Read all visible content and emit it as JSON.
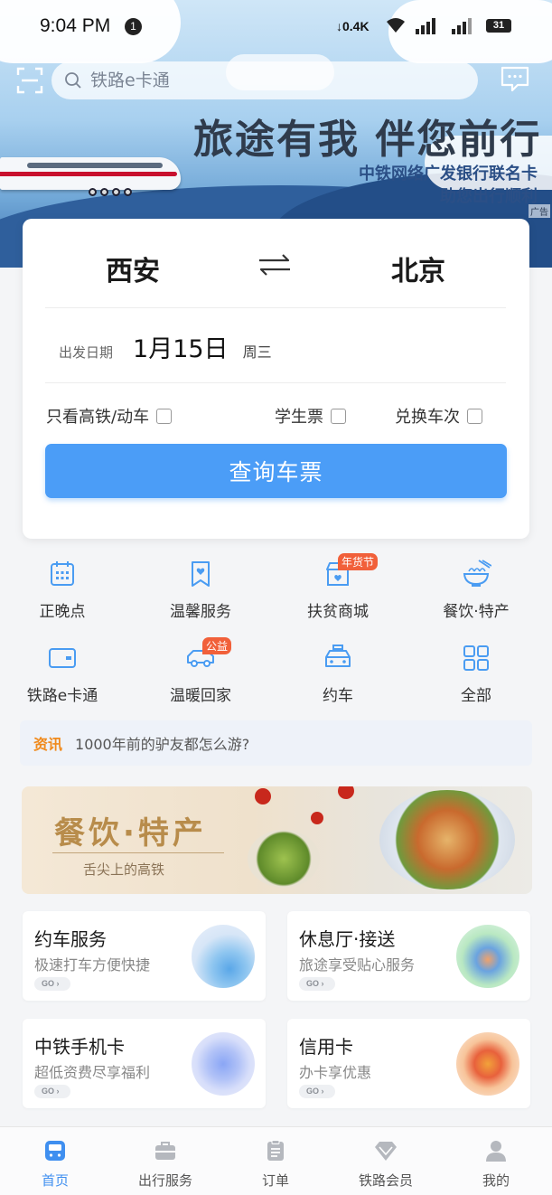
{
  "status_bar": {
    "time": "9:04 PM",
    "notification_count": "1",
    "net_speed": "0.4K",
    "battery": "31"
  },
  "search": {
    "placeholder": "铁路e卡通"
  },
  "banner": {
    "slogan": "旅途有我 伴您前行",
    "line1": "中铁网络广发银行联名卡",
    "line2": "助您出行顺利",
    "ad_tag": "广告"
  },
  "booking": {
    "from_city": "西安",
    "to_city": "北京",
    "date_label": "出发日期",
    "date_value": "1月15日",
    "weekday": "周三",
    "options": [
      {
        "label": "只看高铁/动车",
        "checked": false
      },
      {
        "label": "学生票",
        "checked": false
      },
      {
        "label": "兑换车次",
        "checked": false
      }
    ],
    "query_button": "查询车票"
  },
  "grid": [
    {
      "label": "正晚点",
      "icon": "calendar-icon"
    },
    {
      "label": "温馨服务",
      "icon": "bookmark-heart-icon"
    },
    {
      "label": "扶贫商城",
      "icon": "shop-icon",
      "badge": "年货节"
    },
    {
      "label": "餐饮·特产",
      "icon": "noodle-bowl-icon"
    },
    {
      "label": "铁路e卡通",
      "icon": "card-icon"
    },
    {
      "label": "温暖回家",
      "icon": "car-icon",
      "badge": "公益"
    },
    {
      "label": "约车",
      "icon": "taxi-icon"
    },
    {
      "label": "全部",
      "icon": "grid-icon"
    }
  ],
  "news": {
    "tag": "资讯",
    "text": "1000年前的驴友都怎么游?"
  },
  "promo": {
    "title": "餐饮·特产",
    "subtitle": "舌尖上的高铁"
  },
  "services": [
    {
      "title": "约车服务",
      "subtitle": "极速打车方便快捷",
      "go": "GO"
    },
    {
      "title": "休息厅·接送",
      "subtitle": "旅途享受贴心服务",
      "go": "GO"
    },
    {
      "title": "中铁手机卡",
      "subtitle": "超低资费尽享福利",
      "go": "GO"
    },
    {
      "title": "信用卡",
      "subtitle": "办卡享优惠",
      "go": "GO"
    }
  ],
  "tabs": [
    {
      "label": "首页",
      "icon": "train-icon",
      "active": true
    },
    {
      "label": "出行服务",
      "icon": "briefcase-icon",
      "active": false
    },
    {
      "label": "订单",
      "icon": "clipboard-icon",
      "active": false
    },
    {
      "label": "铁路会员",
      "icon": "diamond-icon",
      "active": false
    },
    {
      "label": "我的",
      "icon": "person-icon",
      "active": false
    }
  ],
  "colors": {
    "primary": "#4b9df7",
    "active_tab": "#3f8ff0",
    "news_tag": "#f08a1c",
    "badge": "#f1603a"
  }
}
